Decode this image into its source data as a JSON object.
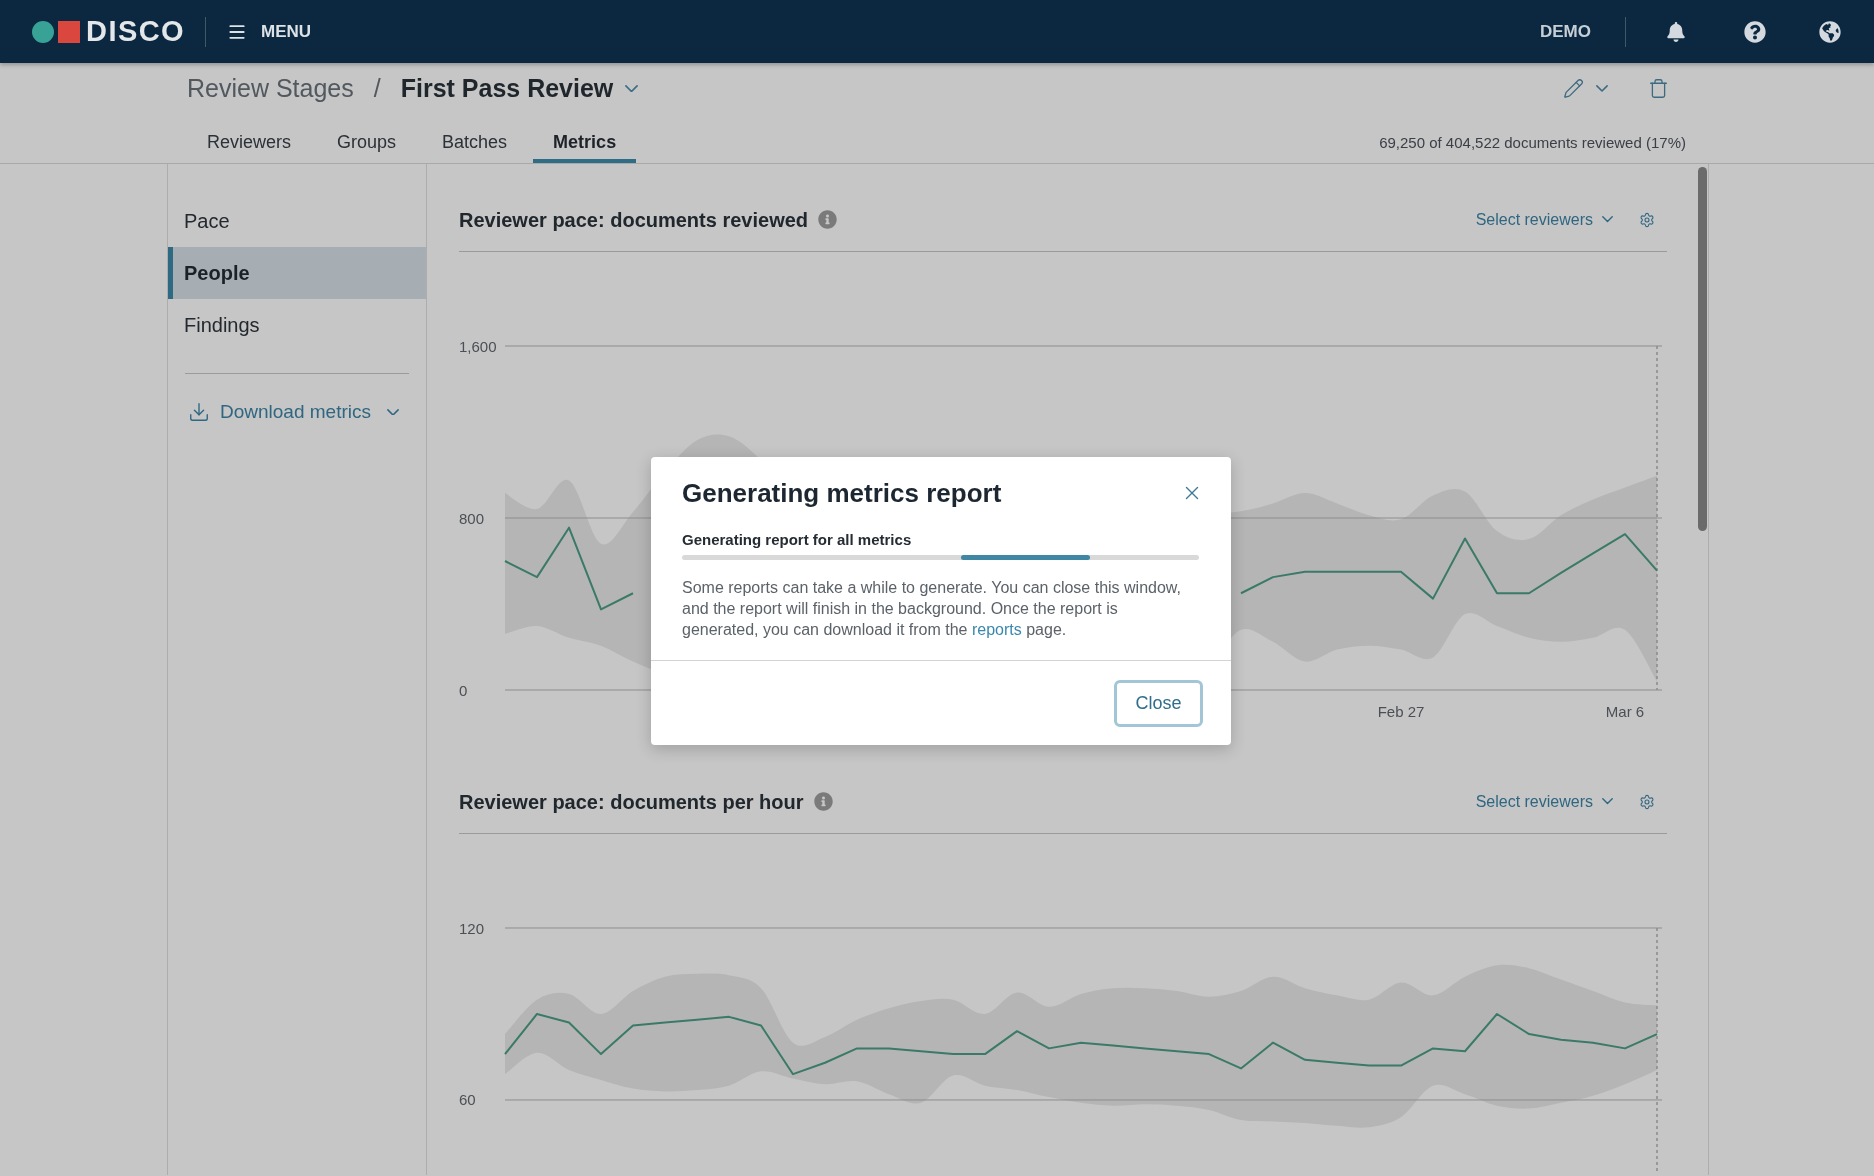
{
  "header": {
    "logo_text": "DISCO",
    "menu_label": "MENU",
    "environment_label": "DEMO"
  },
  "breadcrumb": {
    "parent": "Review Stages",
    "separator": "/",
    "current": "First Pass Review"
  },
  "tabs": [
    {
      "label": "Reviewers",
      "selected": false
    },
    {
      "label": "Groups",
      "selected": false
    },
    {
      "label": "Batches",
      "selected": false
    },
    {
      "label": "Metrics",
      "selected": true
    }
  ],
  "review_progress": "69,250 of 404,522 documents reviewed (17%)",
  "sidebar": {
    "items": [
      {
        "label": "Pace",
        "selected": false
      },
      {
        "label": "People",
        "selected": true
      },
      {
        "label": "Findings",
        "selected": false
      }
    ],
    "download_label": "Download metrics"
  },
  "charts": [
    {
      "title": "Reviewer pace: documents reviewed",
      "select_label": "Select reviewers",
      "chart_data": {
        "type": "line",
        "categories": [
          null,
          null,
          null,
          null,
          null,
          null,
          null,
          null,
          null,
          null,
          null,
          null,
          null,
          null,
          null,
          null,
          null,
          null,
          null,
          null,
          null,
          null,
          null,
          null,
          null,
          null,
          null,
          null,
          "Feb 27",
          null,
          null,
          null,
          null,
          null,
          null,
          "Mar 6",
          null
        ],
        "ylim": [
          0,
          1600
        ],
        "yticks": [
          0,
          800,
          {
            "value": 1600,
            "label": "1,600"
          }
        ],
        "series": [
          {
            "color": "#3b7a68",
            "values": [
              600,
              525,
              755,
              375,
              450,
              null,
              null,
              null,
              null,
              null,
              null,
              null,
              null,
              null,
              null,
              null,
              null,
              null,
              null,
              null,
              null,
              null,
              null,
              450,
              525,
              550,
              550,
              550,
              550,
              425,
              705,
              450,
              450,
              545,
              635,
              725,
              555
            ]
          }
        ]
      }
    },
    {
      "title": "Reviewer pace: documents per hour",
      "select_label": "Select reviewers",
      "chart_data": {
        "type": "line",
        "ylim": [
          34,
          120
        ],
        "yticks": [
          60,
          120
        ],
        "series": [
          {
            "color": "#3b7a68",
            "values": [
              76,
              90,
              87,
              76,
              86,
              87,
              88,
              89,
              86,
              69,
              73,
              78,
              78,
              77,
              76,
              76,
              84,
              78,
              80,
              79,
              78,
              77,
              76,
              71,
              80,
              74,
              73,
              72,
              72,
              78,
              77,
              90,
              83,
              81,
              80,
              78,
              83
            ]
          }
        ]
      }
    }
  ],
  "modal": {
    "title": "Generating metrics report",
    "subtitle": "Generating report for all metrics",
    "progress": {
      "indeterminate": true
    },
    "message_before": "Some reports can take a while to generate. You can close this window, and the report will finish in the background. Once the report is generated, you can download it from the ",
    "message_link": "reports",
    "message_after": " page.",
    "close_button": "Close"
  }
}
